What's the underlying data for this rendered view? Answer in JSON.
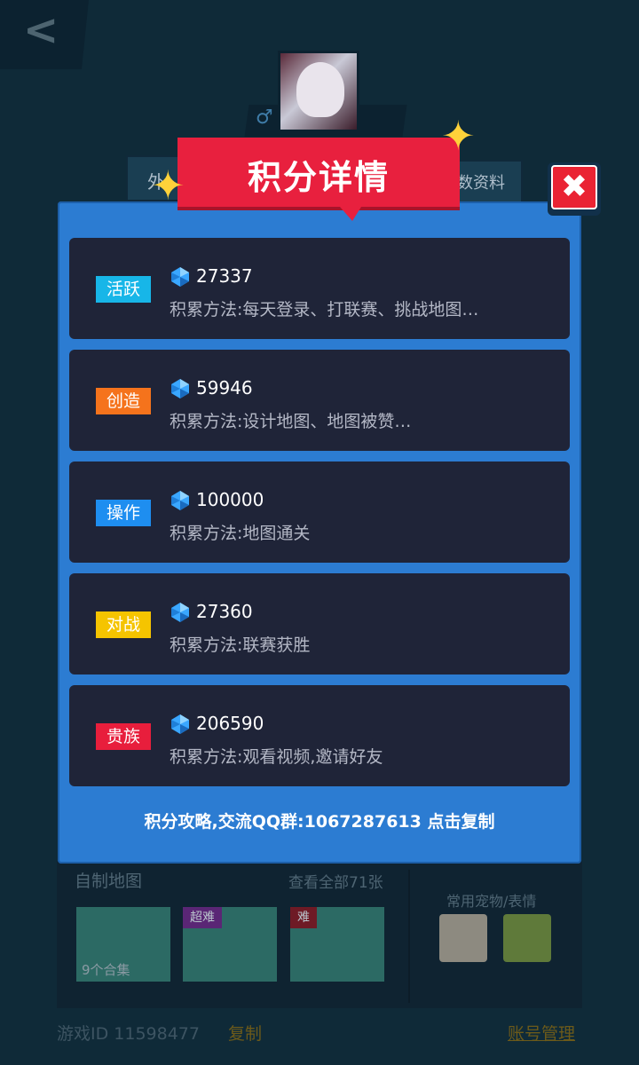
{
  "modal": {
    "title": "积分详情",
    "close_icon": "close-x-icon",
    "footer": "积分攻略,交流QQ群:1067287613 点击复制",
    "items": [
      {
        "tag": "活跃",
        "tag_color": "#17b6e8",
        "score": "27337",
        "method": "积累方法:每天登录、打联赛、挑战地图…"
      },
      {
        "tag": "创造",
        "tag_color": "#f5731c",
        "score": "59946",
        "method": "积累方法:设计地图、地图被赞…"
      },
      {
        "tag": "操作",
        "tag_color": "#1e8ef0",
        "score": "100000",
        "method": "积累方法:地图通关"
      },
      {
        "tag": "对战",
        "tag_color": "#f5c400",
        "score": "27360",
        "method": "积累方法:联赛获胜"
      },
      {
        "tag": "贵族",
        "tag_color": "#e81e3c",
        "score": "206590",
        "method": "积累方法:观看视频,邀请好友"
      }
    ]
  },
  "background": {
    "back_icon": "chevron-left-icon",
    "gender_icon": "male-icon",
    "tab_left": "外",
    "tab_right": "数资料",
    "maps_title": "自制地图",
    "maps_view_all": "查看全部71张",
    "map_tag_super": "超难",
    "map_tag_hard": "难",
    "collection_label": "9个合集",
    "pets_title": "常用宠物/表情",
    "game_id": "游戏ID 11598477",
    "copy": "复制",
    "account": "账号管理"
  }
}
